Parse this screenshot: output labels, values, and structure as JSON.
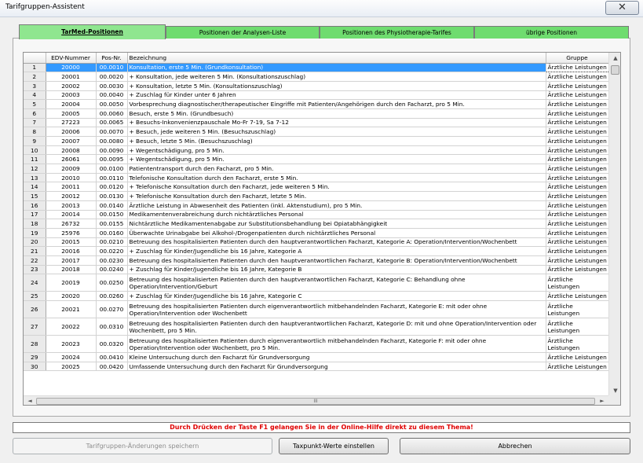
{
  "window": {
    "title": "Tarifgruppen-Assistent",
    "close_symbol": "✕"
  },
  "tabs": [
    {
      "label": "TarMed-Positionen",
      "active": true
    },
    {
      "label": "Positionen der Analysen-Liste",
      "active": false
    },
    {
      "label": "Positionen des Physiotherapie-Tarifes",
      "active": false
    },
    {
      "label": "übrige Positionen",
      "active": false
    }
  ],
  "table": {
    "columns": [
      "",
      "EDV-Nummer",
      "Pos-Nr.",
      "Bezeichnung",
      "Gruppe"
    ],
    "rows": [
      {
        "n": "1",
        "edv": "20000",
        "pos": "00.0010",
        "bez": "Konsultation, erste 5 Min. (Grundkonsultation)",
        "gruppe": "Ärztliche Leistungen",
        "selected": true
      },
      {
        "n": "2",
        "edv": "20001",
        "pos": "00.0020",
        "bez": "+ Konsultation, jede weiteren 5 Min. (Konsultationszuschlag)",
        "gruppe": "Ärztliche Leistungen"
      },
      {
        "n": "3",
        "edv": "20002",
        "pos": "00.0030",
        "bez": "+ Konsultation, letzte 5 Min. (Konsultationszuschlag)",
        "gruppe": "Ärztliche Leistungen"
      },
      {
        "n": "4",
        "edv": "20003",
        "pos": "00.0040",
        "bez": "+ Zuschlag für Kinder unter 6 Jahren",
        "gruppe": "Ärztliche Leistungen"
      },
      {
        "n": "5",
        "edv": "20004",
        "pos": "00.0050",
        "bez": "Vorbesprechung diagnostischer/therapeutischer Eingriffe mit Patienten/Angehörigen durch den Facharzt, pro 5 Min.",
        "gruppe": "Ärztliche Leistungen"
      },
      {
        "n": "6",
        "edv": "20005",
        "pos": "00.0060",
        "bez": "Besuch, erste 5 Min. (Grundbesuch)",
        "gruppe": "Ärztliche Leistungen"
      },
      {
        "n": "7",
        "edv": "27223",
        "pos": "00.0065",
        "bez": "+ Besuchs-Inkonvenienzpauschale Mo-Fr 7-19, Sa 7-12",
        "gruppe": "Ärztliche Leistungen"
      },
      {
        "n": "8",
        "edv": "20006",
        "pos": "00.0070",
        "bez": "+ Besuch, jede weiteren 5 Min. (Besuchszuschlag)",
        "gruppe": "Ärztliche Leistungen"
      },
      {
        "n": "9",
        "edv": "20007",
        "pos": "00.0080",
        "bez": "+ Besuch, letzte 5 Min. (Besuchszuschlag)",
        "gruppe": "Ärztliche Leistungen"
      },
      {
        "n": "10",
        "edv": "20008",
        "pos": "00.0090",
        "bez": "+ Wegentschädigung, pro 5 Min.",
        "gruppe": "Ärztliche Leistungen"
      },
      {
        "n": "11",
        "edv": "26061",
        "pos": "00.0095",
        "bez": "+ Wegentschädigung, pro 5 Min.",
        "gruppe": "Ärztliche Leistungen"
      },
      {
        "n": "12",
        "edv": "20009",
        "pos": "00.0100",
        "bez": "Patiententransport durch den Facharzt, pro 5 Min.",
        "gruppe": "Ärztliche Leistungen"
      },
      {
        "n": "13",
        "edv": "20010",
        "pos": "00.0110",
        "bez": "Telefonische Konsultation durch den Facharzt, erste 5 Min.",
        "gruppe": "Ärztliche Leistungen"
      },
      {
        "n": "14",
        "edv": "20011",
        "pos": "00.0120",
        "bez": "+ Telefonische Konsultation durch den Facharzt, jede weiteren 5 Min.",
        "gruppe": "Ärztliche Leistungen"
      },
      {
        "n": "15",
        "edv": "20012",
        "pos": "00.0130",
        "bez": "+ Telefonische Konsultation durch den Facharzt, letzte 5 Min.",
        "gruppe": "Ärztliche Leistungen"
      },
      {
        "n": "16",
        "edv": "20013",
        "pos": "00.0140",
        "bez": "Ärztliche Leistung in Abwesenheit des Patienten (inkl. Aktenstudium), pro 5 Min.",
        "gruppe": "Ärztliche Leistungen"
      },
      {
        "n": "17",
        "edv": "20014",
        "pos": "00.0150",
        "bez": "Medikamentenverabreichung durch nichtärztliches Personal",
        "gruppe": "Ärztliche Leistungen"
      },
      {
        "n": "18",
        "edv": "26732",
        "pos": "00.0155",
        "bez": "Nichtärztliche Medikamentenabgabe zur Substitutionsbehandlung bei Opiatabhängigkeit",
        "gruppe": "Ärztliche Leistungen"
      },
      {
        "n": "19",
        "edv": "25976",
        "pos": "00.0160",
        "bez": "Überwachte Urinabgabe bei Alkohol-/Drogenpatienten durch nichtärztliches Personal",
        "gruppe": "Ärztliche Leistungen"
      },
      {
        "n": "20",
        "edv": "20015",
        "pos": "00.0210",
        "bez": "Betreuung des hospitalisierten Patienten durch den hauptverantwortlichen Facharzt, Kategorie A: Operation/Intervention/Wochenbett",
        "gruppe": "Ärztliche Leistungen"
      },
      {
        "n": "21",
        "edv": "20016",
        "pos": "00.0220",
        "bez": "+ Zuschlag für Kinder/Jugendliche bis 16 Jahre, Kategorie A",
        "gruppe": "Ärztliche Leistungen"
      },
      {
        "n": "22",
        "edv": "20017",
        "pos": "00.0230",
        "bez": "Betreuung des hospitalisierten Patienten durch den hauptverantwortlichen Facharzt, Kategorie B: Operation/Intervention/Wochenbett",
        "gruppe": "Ärztliche Leistungen"
      },
      {
        "n": "23",
        "edv": "20018",
        "pos": "00.0240",
        "bez": "+ Zuschlag für Kinder/Jugendliche bis 16 Jahre, Kategorie B",
        "gruppe": "Ärztliche Leistungen"
      },
      {
        "n": "24",
        "edv": "20019",
        "pos": "00.0250",
        "bez": "Betreuung des hospitalisierten Patienten durch den hauptverantwortlichen Facharzt, Kategorie C: Behandlung ohne Operation/Intervention/Geburt",
        "gruppe": "Ärztliche Leistungen",
        "tall": true
      },
      {
        "n": "25",
        "edv": "20020",
        "pos": "00.0260",
        "bez": "+ Zuschlag für Kinder/Jugendliche bis 16 Jahre, Kategorie C",
        "gruppe": "Ärztliche Leistungen"
      },
      {
        "n": "26",
        "edv": "20021",
        "pos": "00.0270",
        "bez": "Betreuung des hospitalisierten Patienten durch eigenverantwortlich mitbehandelnden Facharzt, Kategorie E: mit oder ohne Operation/Intervention oder Wochenbett",
        "gruppe": "Ärztliche Leistungen",
        "tall": true
      },
      {
        "n": "27",
        "edv": "20022",
        "pos": "00.0310",
        "bez": "Betreuung des hospitalisierten Patienten durch den hauptverantwortlichen Facharzt, Kategorie D: mit und ohne Operation/Intervention oder Wochenbett, pro 5 Min.",
        "gruppe": "Ärztliche Leistungen",
        "tall": true
      },
      {
        "n": "28",
        "edv": "20023",
        "pos": "00.0320",
        "bez": "Betreuung des hospitalisierten Patienten durch eigenverantwortlich mitbehandelnden Facharzt, Kategorie F: mit oder ohne Operation/Intervention oder Wochenbett, pro 5 Min.",
        "gruppe": "Ärztliche Leistungen",
        "tall": true
      },
      {
        "n": "29",
        "edv": "20024",
        "pos": "00.0410",
        "bez": "Kleine Untersuchung durch den Facharzt für Grundversorgung",
        "gruppe": "Ärztliche Leistungen"
      },
      {
        "n": "30",
        "edv": "20025",
        "pos": "00.0420",
        "bez": "Umfassende Untersuchung durch den Facharzt für Grundversorgung",
        "gruppe": "Ärztliche Leistungen"
      }
    ]
  },
  "scroll": {
    "up": "▲",
    "down": "▼",
    "left": "◄",
    "right": "►",
    "grip": "III"
  },
  "status_message": "Durch Drücken der Taste F1 gelangen Sie in der Online-Hilfe direkt zu diesem Thema!",
  "buttons": {
    "save": "Tarifgruppen-Änderungen speichern",
    "taxpunkt": "Taxpunkt-Werte einstellen",
    "cancel": "Abbrechen"
  }
}
